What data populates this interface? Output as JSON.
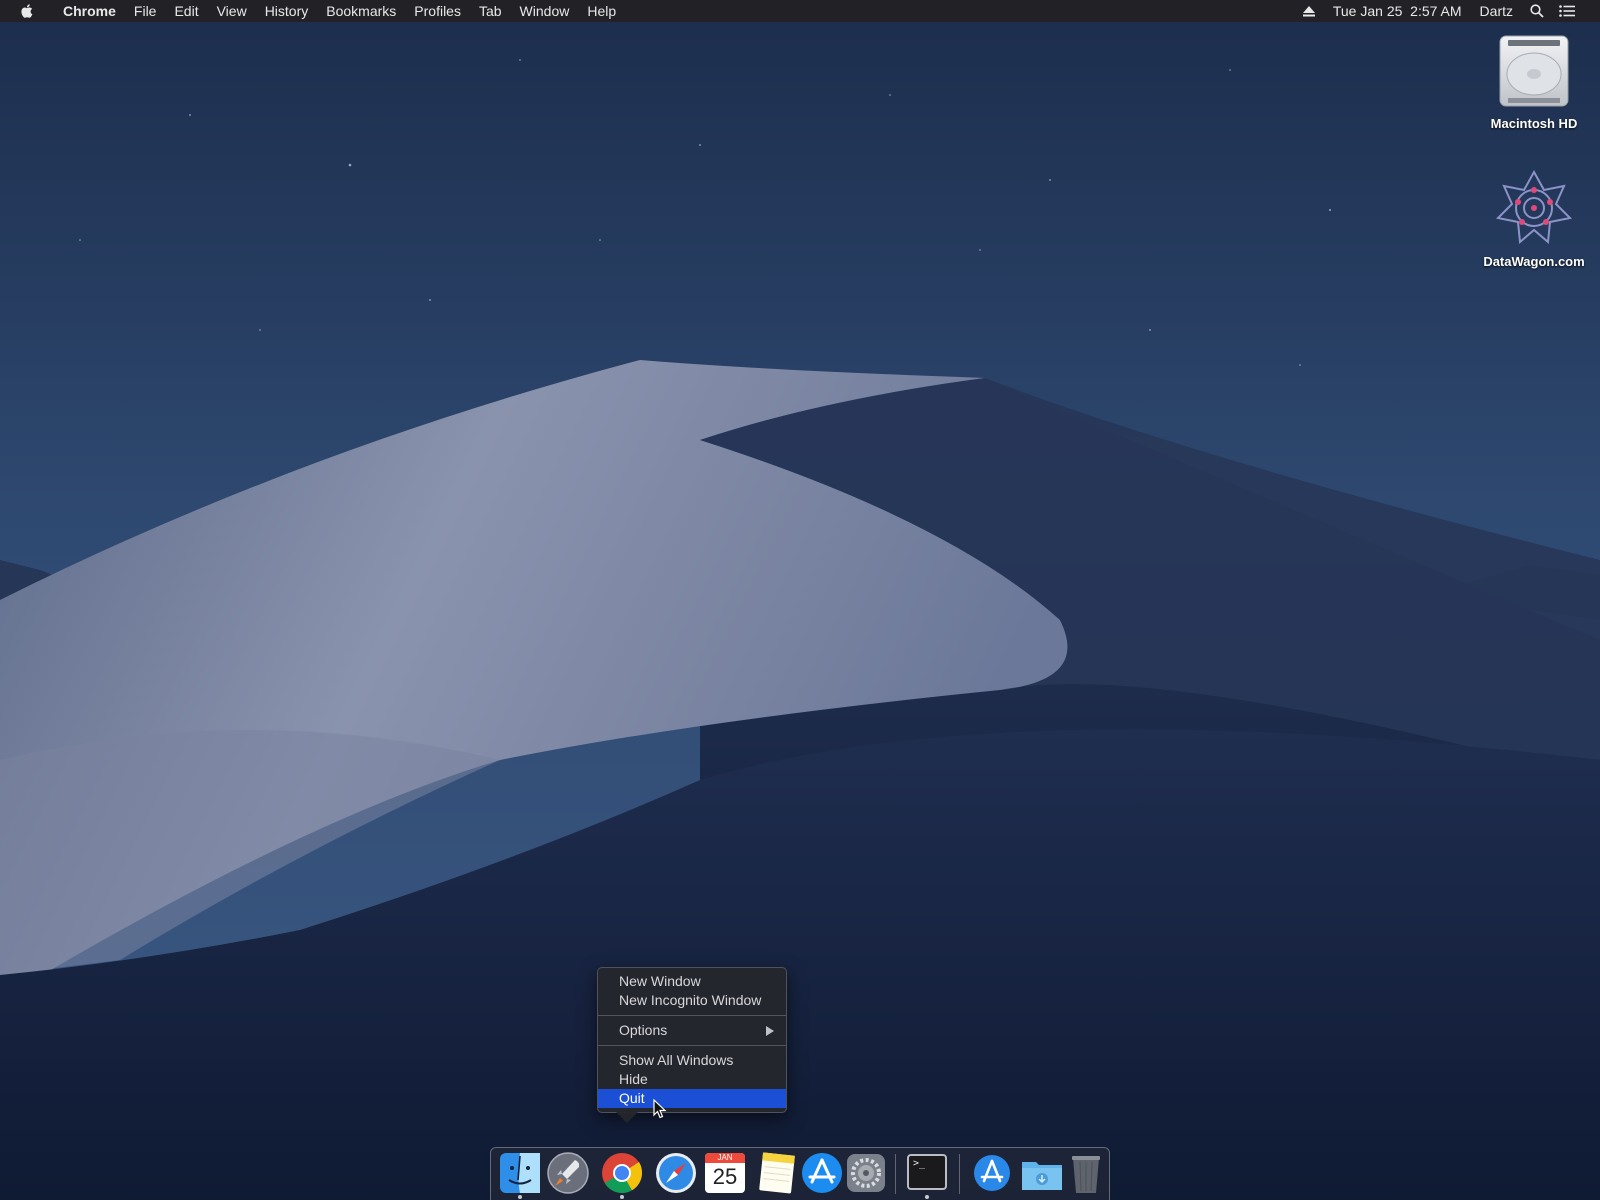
{
  "menubar": {
    "app_name": "Chrome",
    "menus": [
      "File",
      "Edit",
      "View",
      "History",
      "Bookmarks",
      "Profiles",
      "Tab",
      "Window",
      "Help"
    ],
    "status": {
      "datetime": "Tue Jan 25  2:57 AM",
      "user": "Dartz",
      "icons": [
        "eject-icon",
        "spotlight-search-icon",
        "notification-center-icon"
      ]
    }
  },
  "desktop": {
    "icons": [
      {
        "label": "Macintosh HD",
        "icon": "hard-drive-icon"
      },
      {
        "label": "DataWagon.com",
        "icon": "datawagon-logo-icon"
      }
    ]
  },
  "context_menu": {
    "items": [
      {
        "label": "New Window"
      },
      {
        "label": "New Incognito Window"
      },
      {
        "label": "Options",
        "submenu": true
      },
      {
        "label": "Show All Windows"
      },
      {
        "label": "Hide"
      },
      {
        "label": "Quit",
        "highlighted": true
      }
    ],
    "highlight_color": "#1a4fd6"
  },
  "dock": {
    "apps": [
      {
        "name": "Finder",
        "icon": "finder-icon",
        "running": true
      },
      {
        "name": "Launchpad",
        "icon": "launchpad-rocket-icon",
        "running": false
      },
      {
        "name": "Google Chrome",
        "icon": "chrome-icon",
        "running": true
      },
      {
        "name": "Safari",
        "icon": "safari-compass-icon",
        "running": false
      },
      {
        "name": "Calendar",
        "icon": "calendar-icon",
        "running": false,
        "month": "JAN",
        "day": "25"
      },
      {
        "name": "Notes",
        "icon": "notes-icon",
        "running": false
      },
      {
        "name": "App Store",
        "icon": "app-store-icon",
        "running": false
      },
      {
        "name": "System Preferences",
        "icon": "gear-icon",
        "running": false
      },
      {
        "name": "Terminal",
        "icon": "terminal-icon",
        "running": true,
        "prompt": ">_"
      },
      {
        "name": "Applications",
        "icon": "applications-folder-icon",
        "running": false
      },
      {
        "name": "Downloads",
        "icon": "downloads-folder-icon",
        "running": false
      },
      {
        "name": "Trash",
        "icon": "trash-icon",
        "running": false
      }
    ]
  }
}
